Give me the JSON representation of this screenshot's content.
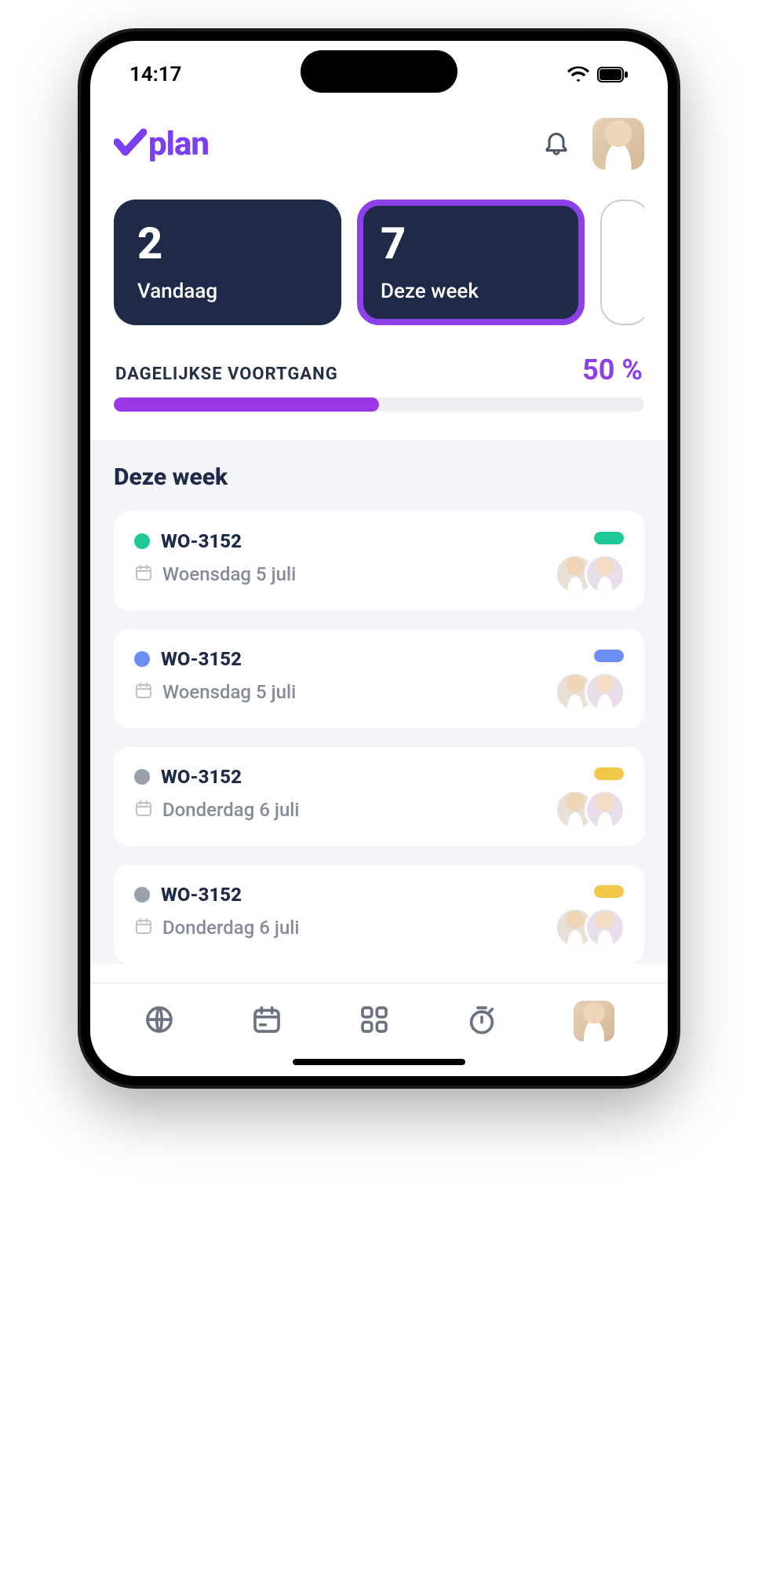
{
  "status": {
    "time": "14:17"
  },
  "header": {
    "logo_text": "plan"
  },
  "summary": [
    {
      "count": "2",
      "label": "Vandaag",
      "active": false
    },
    {
      "count": "7",
      "label": "Deze week",
      "active": true
    }
  ],
  "progress": {
    "label": "DAGELIJKSE VOORTGANG",
    "percent_text": "50 %",
    "percent": 50
  },
  "section": {
    "title": "Deze week"
  },
  "tasks": [
    {
      "id": "WO-3152",
      "date": "Woensdag 5 juli",
      "dot": "#1ec997",
      "pill": "#1ec997"
    },
    {
      "id": "WO-3152",
      "date": "Woensdag 5 juli",
      "dot": "#6b8df5",
      "pill": "#6b8df5"
    },
    {
      "id": "WO-3152",
      "date": "Donderdag 6 juli",
      "dot": "#9aa1ad",
      "pill": "#f2c84b"
    },
    {
      "id": "WO-3152",
      "date": "Donderdag 6 juli",
      "dot": "#9aa1ad",
      "pill": "#f2c84b"
    }
  ],
  "colors": {
    "accent": "#8d3fe8",
    "card_bg": "#1e2a47"
  }
}
